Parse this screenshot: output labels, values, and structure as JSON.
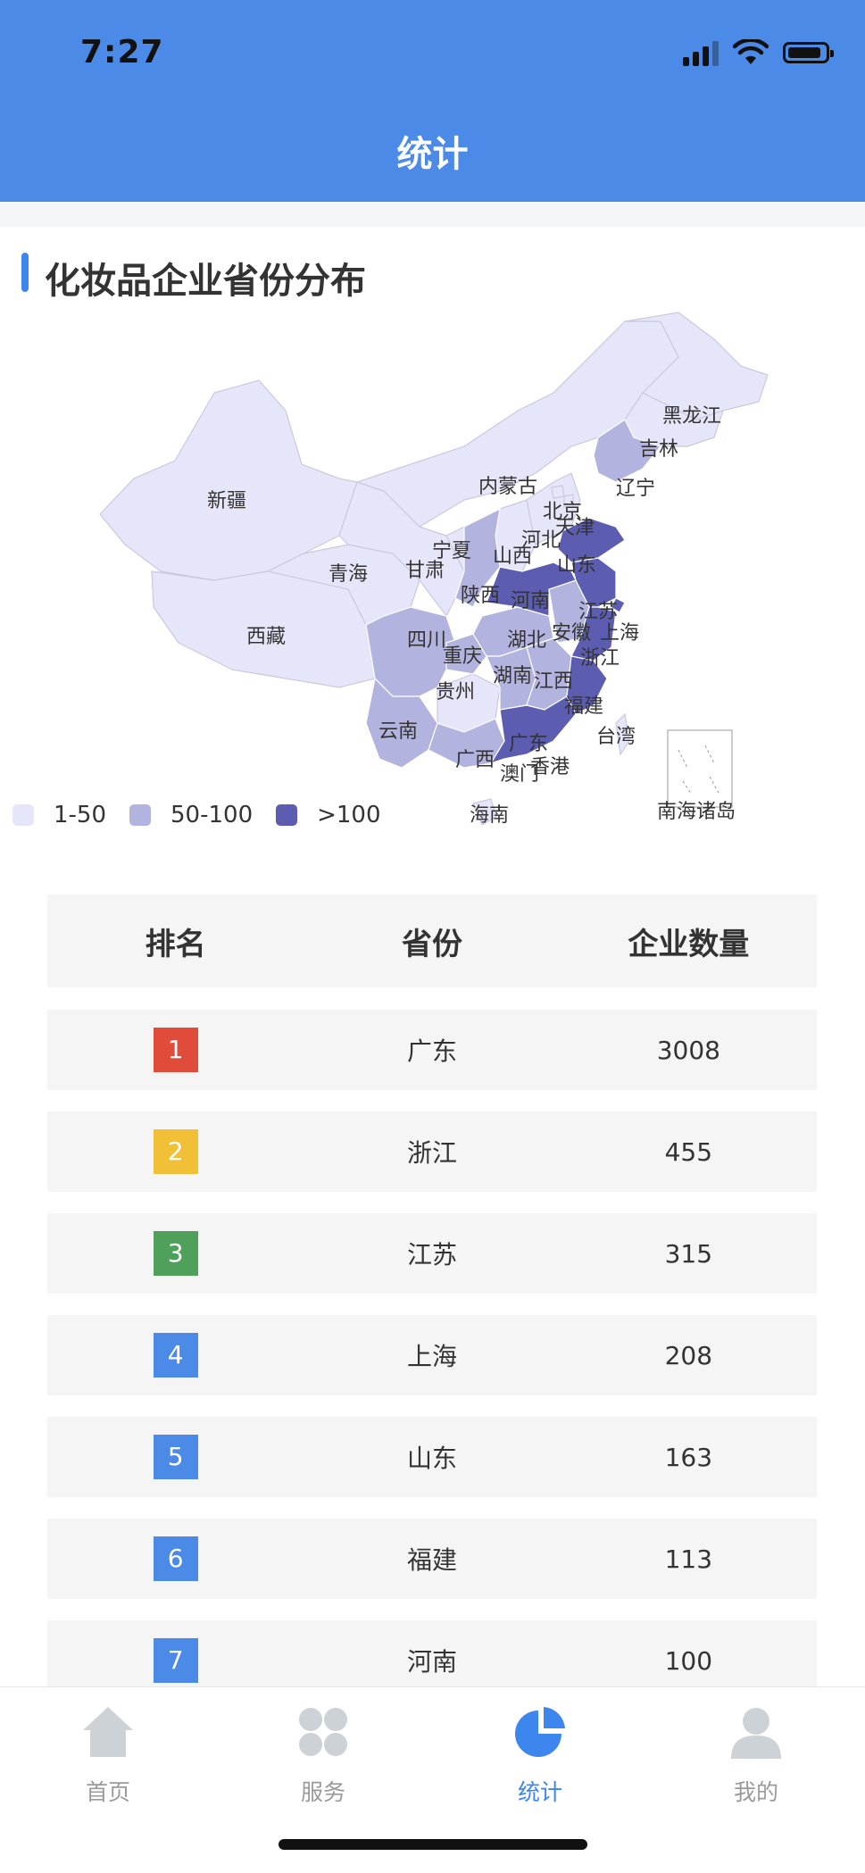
{
  "status_bar": {
    "time": "7:27"
  },
  "header": {
    "title": "统计"
  },
  "section": {
    "title": "化妆品企业省份分布"
  },
  "map": {
    "labels": [
      "黑龙江",
      "吉林",
      "辽宁",
      "内蒙古",
      "北京",
      "天津",
      "河北",
      "新疆",
      "宁夏",
      "山西",
      "山东",
      "青海",
      "甘肃",
      "陕西",
      "河南",
      "江苏",
      "西藏",
      "四川",
      "重庆",
      "湖北",
      "安徽",
      "上海",
      "浙江",
      "湖南",
      "江西",
      "贵州",
      "福建",
      "云南",
      "广西",
      "广东",
      "香港",
      "澳门",
      "台湾",
      "海南",
      "南海诸岛"
    ],
    "colors": {
      "low": "#e6e6fb",
      "mid": "#b3b3e0",
      "high": "#5c5cb0",
      "border": "#ffffff"
    }
  },
  "legend": [
    {
      "label": "1-50",
      "color": "#e6e6fb"
    },
    {
      "label": "50-100",
      "color": "#b3b3e0"
    },
    {
      "label": ">100",
      "color": "#5c5cb0"
    }
  ],
  "table": {
    "headers": [
      "排名",
      "省份",
      "企业数量"
    ],
    "rows": [
      {
        "rank": "1",
        "province": "广东",
        "count": "3008",
        "badge_color": "#e04b3a"
      },
      {
        "rank": "2",
        "province": "浙江",
        "count": "455",
        "badge_color": "#f2c037"
      },
      {
        "rank": "3",
        "province": "江苏",
        "count": "315",
        "badge_color": "#4fa05a"
      },
      {
        "rank": "4",
        "province": "上海",
        "count": "208",
        "badge_color": "#4c8ae8"
      },
      {
        "rank": "5",
        "province": "山东",
        "count": "163",
        "badge_color": "#4c8ae8"
      },
      {
        "rank": "6",
        "province": "福建",
        "count": "113",
        "badge_color": "#4c8ae8"
      },
      {
        "rank": "7",
        "province": "河南",
        "count": "100",
        "badge_color": "#4c8ae8"
      }
    ]
  },
  "tabbar": {
    "items": [
      {
        "label": "首页",
        "icon": "home-icon"
      },
      {
        "label": "服务",
        "icon": "grid-icon"
      },
      {
        "label": "统计",
        "icon": "pie-chart-icon"
      },
      {
        "label": "我的",
        "icon": "user-icon"
      }
    ],
    "active_color": "#3d86ee",
    "inactive_color": "#cdd2d7"
  }
}
